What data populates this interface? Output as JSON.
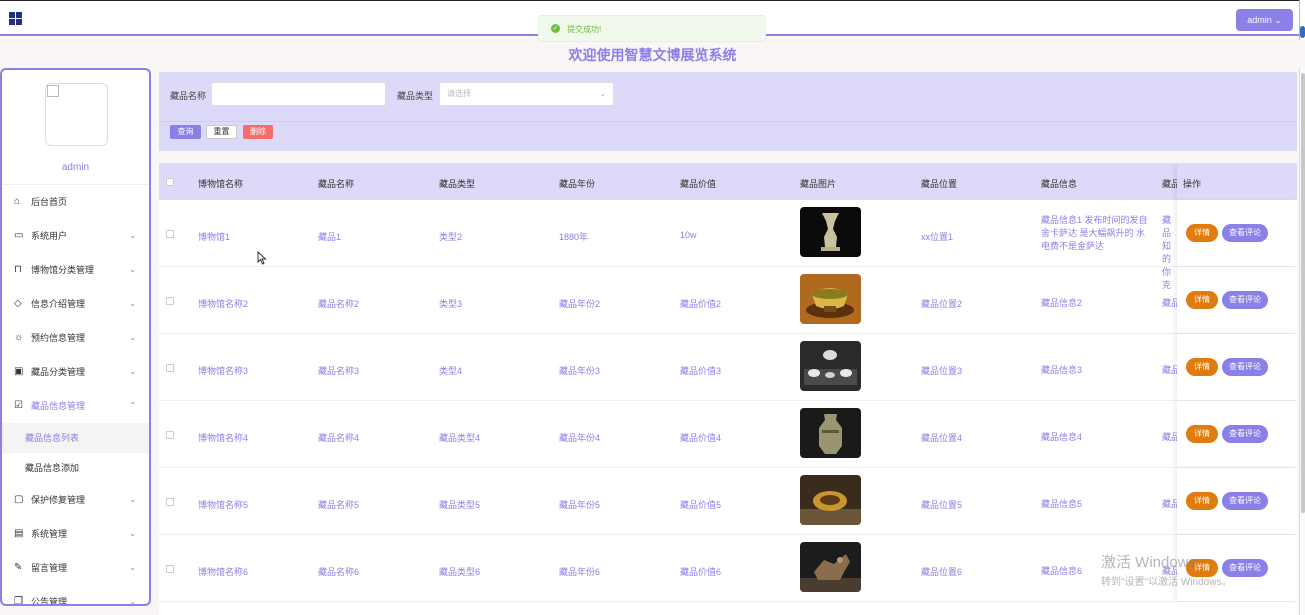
{
  "header": {
    "user_label": "admin",
    "toast_message": "提交成功!"
  },
  "page_title": "欢迎使用智慧文博展览系统",
  "sidebar": {
    "username": "admin",
    "items": [
      {
        "label": "后台首页",
        "icon": "home-icon"
      },
      {
        "label": "系统用户",
        "icon": "monitor-icon"
      },
      {
        "label": "博物馆分类管理",
        "icon": "bookmark-icon"
      },
      {
        "label": "信息介绍管理",
        "icon": "tag-icon"
      },
      {
        "label": "预约信息管理",
        "icon": "sun-icon"
      },
      {
        "label": "藏品分类管理",
        "icon": "inbox-icon"
      },
      {
        "label": "藏品信息管理",
        "icon": "clipboard-icon"
      },
      {
        "label": "保护修复管理",
        "icon": "chat-icon"
      },
      {
        "label": "系统管理",
        "icon": "box-icon"
      },
      {
        "label": "留言管理",
        "icon": "paperclip-icon"
      },
      {
        "label": "公告管理",
        "icon": "copy-icon"
      }
    ],
    "sub_items": [
      "藏品信息列表",
      "藏品信息添加"
    ]
  },
  "search": {
    "name_label": "藏品名称",
    "name_value": "",
    "type_label": "藏品类型",
    "type_placeholder": "请选择",
    "query_label": "查询",
    "reset_label": "重置",
    "delete_label": "删除"
  },
  "table": {
    "headers": [
      "博物馆名称",
      "藏品名称",
      "藏品类型",
      "藏品年份",
      "藏品价值",
      "藏品图片",
      "藏品位置",
      "藏品信息",
      "藏品",
      "操作"
    ],
    "detail_label": "详情",
    "comment_label": "查看评论",
    "rows": [
      {
        "museum": "博物馆1",
        "name": "藏品1",
        "type": "类型2",
        "year": "1880年",
        "value": "10w",
        "location": "xx位置1",
        "info": "藏品信息1 发布时间的发自舍卡萨达 是大幅飙升的 水电费不是金萨达",
        "extra": "藏品 知 的 你克",
        "img": "vase"
      },
      {
        "museum": "博物馆名称2",
        "name": "藏品名称2",
        "type": "类型3",
        "year": "藏品年份2",
        "value": "藏品价值2",
        "location": "藏品位置2",
        "info": "藏品信息2",
        "extra": "藏品",
        "img": "bowl"
      },
      {
        "museum": "博物馆名称3",
        "name": "藏品名称3",
        "type": "类型4",
        "year": "藏品年份3",
        "value": "藏品价值3",
        "location": "藏品位置3",
        "info": "藏品信息3",
        "extra": "藏品",
        "img": "set"
      },
      {
        "museum": "博物馆名称4",
        "name": "藏品名称4",
        "type": "藏品类型4",
        "year": "藏品年份4",
        "value": "藏品价值4",
        "location": "藏品位置4",
        "info": "藏品信息4",
        "extra": "藏品",
        "img": "jar"
      },
      {
        "museum": "博物馆名称5",
        "name": "藏品名称5",
        "type": "藏品类型5",
        "year": "藏品年份5",
        "value": "藏品价值5",
        "location": "藏品位置5",
        "info": "藏品信息5",
        "extra": "藏品",
        "img": "plate"
      },
      {
        "museum": "博物馆名称6",
        "name": "藏品名称6",
        "type": "藏品类型6",
        "year": "藏品年份6",
        "value": "藏品价值6",
        "location": "藏品位置6",
        "info": "藏品信息6",
        "extra": "藏品",
        "img": "bronze"
      }
    ]
  },
  "watermark": {
    "line1": "激活 Windows",
    "line2": "转到\"设置\"以激活 Windows。"
  },
  "colors": {
    "accent": "#8a80e8",
    "accent_light": "#dcdaf8",
    "danger": "#f56c6c",
    "warning": "#e07b0e",
    "success": "#67c23a"
  }
}
